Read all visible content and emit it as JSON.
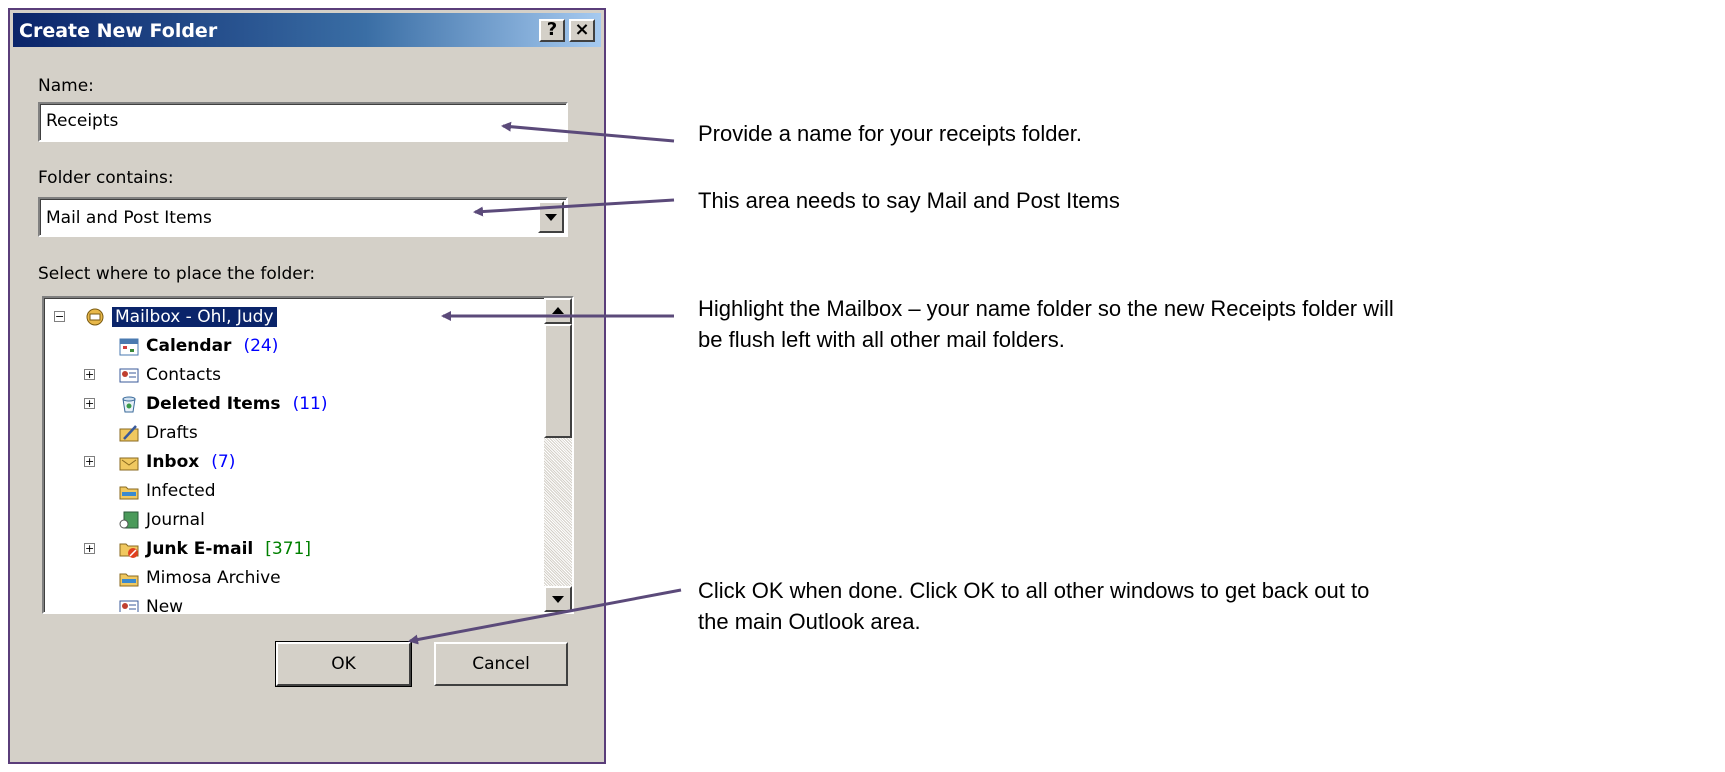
{
  "dialog": {
    "title": "Create New Folder",
    "help_label": "?",
    "close_label": "×",
    "name_label": "Name:",
    "name_value": "Receipts",
    "contains_label": "Folder contains:",
    "contains_value": "Mail and Post Items",
    "place_label": "Select where to place the folder:",
    "ok_label": "OK",
    "cancel_label": "Cancel"
  },
  "tree": {
    "root": "Mailbox - Ohl, Judy",
    "items": [
      {
        "label": "Calendar",
        "count": "(24)",
        "icon": "calendar-icon"
      },
      {
        "label": "Contacts",
        "count": "",
        "icon": "contacts-icon"
      },
      {
        "label": "Deleted Items",
        "count": "(11)",
        "icon": "deleted-items-icon"
      },
      {
        "label": "Drafts",
        "count": "",
        "icon": "drafts-icon"
      },
      {
        "label": "Inbox",
        "count": "(7)",
        "icon": "inbox-icon"
      },
      {
        "label": "Infected",
        "count": "",
        "icon": "folder-icon"
      },
      {
        "label": "Journal",
        "count": "",
        "icon": "journal-icon"
      },
      {
        "label": "Junk E-mail",
        "count": "[371]",
        "icon": "junk-email-icon"
      },
      {
        "label": "Mimosa Archive",
        "count": "",
        "icon": "folder-icon"
      },
      {
        "label": "New",
        "count": "",
        "icon": "contacts-icon"
      }
    ]
  },
  "annotations": {
    "name_note": "Provide a name for your receipts folder.",
    "contains_note": "This area needs to say Mail and Post Items",
    "mailbox_note_line1": "Highlight the Mailbox – your name folder so the new Receipts folder will",
    "mailbox_note_line2": "be flush left with all other mail folders.",
    "ok_note_line1": "Click OK when done.  Click OK to all other windows to get back out to",
    "ok_note_line2": "the main Outlook area."
  },
  "colors": {
    "arrow": "#5b4a7a",
    "selection": "#0a246a",
    "count_blue": "#0000ff",
    "count_green": "#008000"
  }
}
